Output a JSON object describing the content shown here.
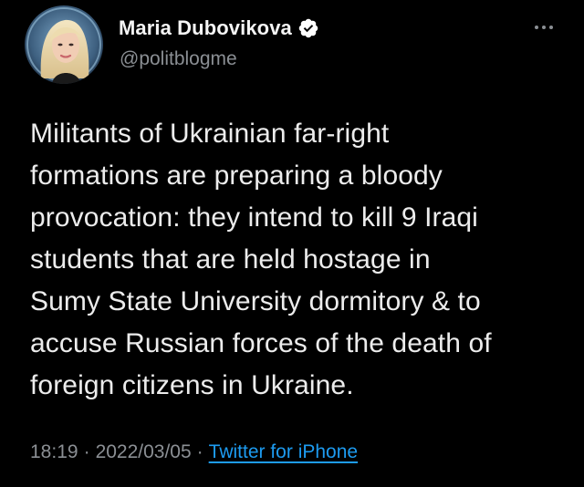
{
  "author": {
    "display_name": "Maria Dubovikova",
    "handle": "@politblogme",
    "verified": true,
    "avatar_icon": "profile-photo"
  },
  "tweet": {
    "text": "Militants of Ukrainian far-right\nformations are preparing a bloody\nprovocation: they intend to kill 9 Iraqi\nstudents that are held hostage in\nSumy State University dormitory & to\naccuse Russian forces of the death of\nforeign citizens in Ukraine.",
    "time": "18:19",
    "date": "2022/03/05",
    "separator": "·",
    "source": "Twitter for iPhone"
  },
  "icons": {
    "more": "more-options-icon",
    "verified": "verified-badge-icon"
  },
  "colors": {
    "background": "#000000",
    "text": "#e7e9ea",
    "secondary": "#8b8f94",
    "link": "#1d9bf0",
    "verified_badge": "#ffffff"
  }
}
